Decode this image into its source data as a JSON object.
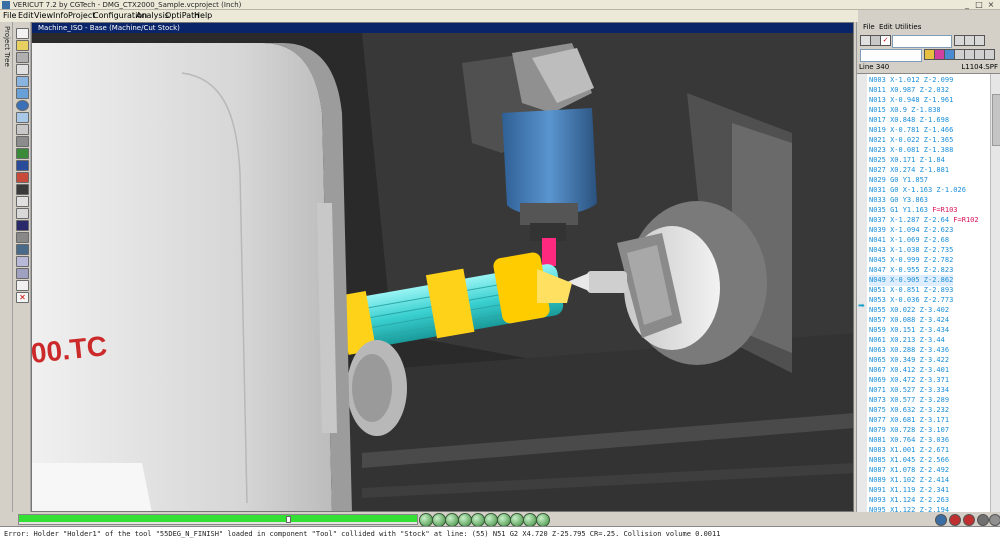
{
  "window": {
    "title": "VERICUT 7.2 by CGTech - DMG_CTX2000_Sample.vcproject (Inch)",
    "controls": [
      "_",
      "□",
      "×"
    ]
  },
  "menubar": {
    "items": [
      "File",
      "Edit",
      "View",
      "Info",
      "Project",
      "Configuration",
      "Analysis",
      "OptiPath",
      "Help"
    ]
  },
  "left_tab": {
    "label": "Project Tree"
  },
  "viewport": {
    "title": "Machine_ISO - Base (Machine/Cut Stock)",
    "machine_label": "00.TC",
    "colors": {
      "background": "#2c2c2c",
      "enclosure": "#d8d8d8",
      "spindle": "#4a7fb5",
      "workpiece": "#4ad8d8",
      "fixture": "#ffd21a",
      "collision": "#ff2a80"
    }
  },
  "nc_panel": {
    "menu": [
      "File",
      "Edit",
      "Utilities"
    ],
    "line_label": "Line 340",
    "file_label": "L1104.SPF",
    "current_line_index": 20,
    "lines": [
      {
        "text": "N003 X-1.012 Z-2.099"
      },
      {
        "text": "N011 X0.987 Z-2.032"
      },
      {
        "text": "N013 X-0.948 Z-1.961"
      },
      {
        "text": "N015 X0.9 Z-1.838"
      },
      {
        "text": "N017 X0.848 Z-1.698"
      },
      {
        "text": "N019 X-0.781 Z-1.466"
      },
      {
        "text": "N021 X-0.022 Z-1.365"
      },
      {
        "text": "N023 X-0.081 Z-1.388"
      },
      {
        "text": "N025 X0.171 Z-1.84"
      },
      {
        "text": "N027 X0.274 Z-1.881"
      },
      {
        "text": "N029 G0 Y1.857"
      },
      {
        "text": "N031 G0 X-1.163 Z-1.026"
      },
      {
        "text": "N033 G0 Y3.863"
      },
      {
        "text": "N035 G1 Y1.163 ",
        "f": "F=R103"
      },
      {
        "text": "N037 X-1.287 Z-2.64 ",
        "f": "F=R102"
      },
      {
        "text": "N039 X-1.094 Z-2.623"
      },
      {
        "text": "N041 X-1.069 Z-2.68"
      },
      {
        "text": "N043 X-1.038 Z-2.735"
      },
      {
        "text": "N045 X-0.999 Z-2.782"
      },
      {
        "text": "N047 X-0.955 Z-2.823"
      },
      {
        "text": "N049 X-0.905 Z-2.862"
      },
      {
        "text": "N051 X-0.851 Z-2.893"
      },
      {
        "text": "N053 X-0.036 Z-2.773"
      },
      {
        "text": "N055 X0.022 Z-3.402"
      },
      {
        "text": "N057 X0.088 Z-3.424"
      },
      {
        "text": "N059 X0.151 Z-3.434"
      },
      {
        "text": "N061 X0.213 Z-3.44"
      },
      {
        "text": "N063 X0.288 Z-3.436"
      },
      {
        "text": "N065 X0.349 Z-3.422"
      },
      {
        "text": "N067 X0.412 Z-3.401"
      },
      {
        "text": "N069 X0.472 Z-3.371"
      },
      {
        "text": "N071 X0.527 Z-3.334"
      },
      {
        "text": "N073 X0.577 Z-3.289"
      },
      {
        "text": "N075 X0.632 Z-3.232"
      },
      {
        "text": "N077 X0.681 Z-3.171"
      },
      {
        "text": "N079 X0.728 Z-3.107"
      },
      {
        "text": "N081 X0.764 Z-3.036"
      },
      {
        "text": "N083 X1.001 Z-2.671"
      },
      {
        "text": "N085 X1.045 Z-2.566"
      },
      {
        "text": "N087 X1.078 Z-2.492"
      },
      {
        "text": "N089 X1.102 Z-2.414"
      },
      {
        "text": "N091 X1.119 Z-2.341"
      },
      {
        "text": "N093 X1.124 Z-2.263"
      },
      {
        "text": "N095 X1.122 Z-2.194"
      }
    ]
  },
  "progress": {
    "fraction": 1.0,
    "marker_fraction": 0.67
  },
  "playback": {
    "button_labels": [
      "RESET",
      "STEP",
      "STOP",
      "PLAY",
      "LOOP",
      "RUN",
      "REWIND",
      "FF",
      "END",
      "CUT"
    ]
  },
  "status": {
    "message": "Error: Holder \"Holder1\" of the tool \"55DEG_N_FINISH\" loaded in component \"Tool\" collided with \"Stock\" at line: (55) N51 G2 X4.720 Z-25.795 CR=.25. Collision volume 0.0011"
  }
}
